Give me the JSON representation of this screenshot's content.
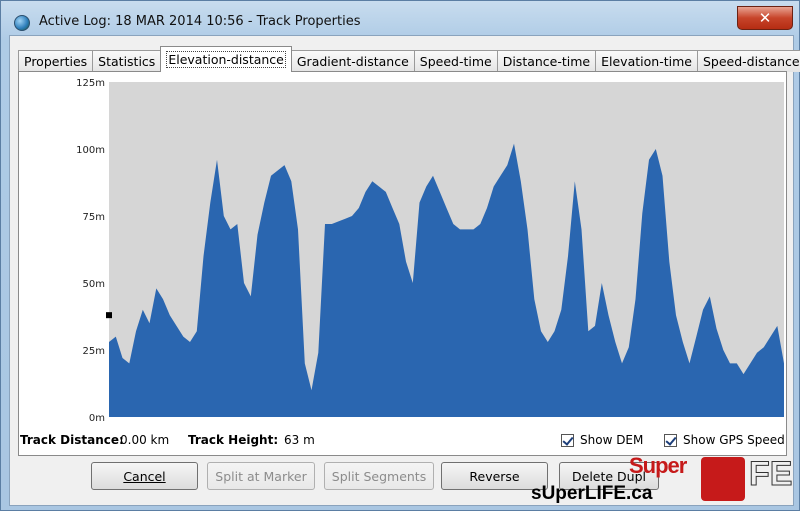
{
  "window": {
    "title": "Active Log: 18 MAR 2014 10:56 - Track Properties",
    "close_glyph": "✕"
  },
  "tabs": [
    {
      "label": "Properties",
      "active": false
    },
    {
      "label": "Statistics",
      "active": false
    },
    {
      "label": "Elevation-distance",
      "active": true
    },
    {
      "label": "Gradient-distance",
      "active": false
    },
    {
      "label": "Speed-time",
      "active": false
    },
    {
      "label": "Distance-time",
      "active": false
    },
    {
      "label": "Elevation-time",
      "active": false
    },
    {
      "label": "Speed-distance",
      "active": false
    }
  ],
  "chart_data": {
    "type": "area",
    "title": "",
    "xlabel": "",
    "ylabel": "",
    "ylim": [
      0,
      125
    ],
    "y_ticks": [
      "0m",
      "25m",
      "50m",
      "75m",
      "100m",
      "125m"
    ],
    "grid": false,
    "fill_color": "#2a66b0",
    "background_color": "#d6d6d6",
    "x": [
      0,
      1,
      2,
      3,
      4,
      5,
      6,
      7,
      8,
      9,
      10,
      11,
      12,
      13,
      14,
      15,
      16,
      17,
      18,
      19,
      20,
      21,
      22,
      23,
      24,
      25,
      26,
      27,
      28,
      29,
      30,
      31,
      32,
      33,
      34,
      35,
      36,
      37,
      38,
      39,
      40,
      41,
      42,
      43,
      44,
      45,
      46,
      47,
      48,
      49,
      50,
      51,
      52,
      53,
      54,
      55,
      56,
      57,
      58,
      59,
      60,
      61,
      62,
      63,
      64,
      65,
      66,
      67,
      68,
      69,
      70,
      71,
      72,
      73,
      74,
      75,
      76,
      77,
      78,
      79,
      80,
      81,
      82,
      83,
      84,
      85,
      86,
      87,
      88,
      89,
      90,
      91,
      92,
      93,
      94,
      95,
      96,
      97,
      98,
      99,
      100
    ],
    "elevation_m": [
      28,
      30,
      22,
      20,
      32,
      40,
      35,
      48,
      44,
      38,
      34,
      30,
      28,
      32,
      60,
      80,
      96,
      75,
      70,
      72,
      50,
      45,
      68,
      80,
      90,
      92,
      94,
      88,
      70,
      20,
      10,
      24,
      72,
      72,
      73,
      74,
      75,
      78,
      84,
      88,
      86,
      84,
      78,
      72,
      58,
      50,
      80,
      86,
      90,
      84,
      78,
      72,
      70,
      70,
      70,
      72,
      78,
      86,
      90,
      94,
      102,
      88,
      70,
      44,
      32,
      28,
      32,
      40,
      60,
      88,
      70,
      32,
      34,
      50,
      38,
      28,
      20,
      26,
      44,
      76,
      96,
      100,
      90,
      58,
      38,
      28,
      20,
      30,
      40,
      45,
      33,
      25,
      20,
      20,
      16,
      20,
      24,
      26,
      30,
      34,
      20
    ]
  },
  "status": {
    "track_distance_label": "Track Distance:",
    "track_distance_value": "0.00 km",
    "track_height_label": "Track Height:",
    "track_height_value": "63 m",
    "show_dem_label": "Show DEM",
    "show_dem_checked": true,
    "show_gps_speed_label": "Show GPS Speed",
    "show_gps_speed_checked": true
  },
  "buttons": {
    "cancel": "Cancel",
    "split_at_marker": "Split at Marker",
    "split_segments": "Split Segments",
    "reverse": "Reverse",
    "delete_dupl": "Delete Dupl"
  },
  "watermark": {
    "url": "sUperLIFE.ca",
    "super": "Super",
    "fe": "FE"
  }
}
